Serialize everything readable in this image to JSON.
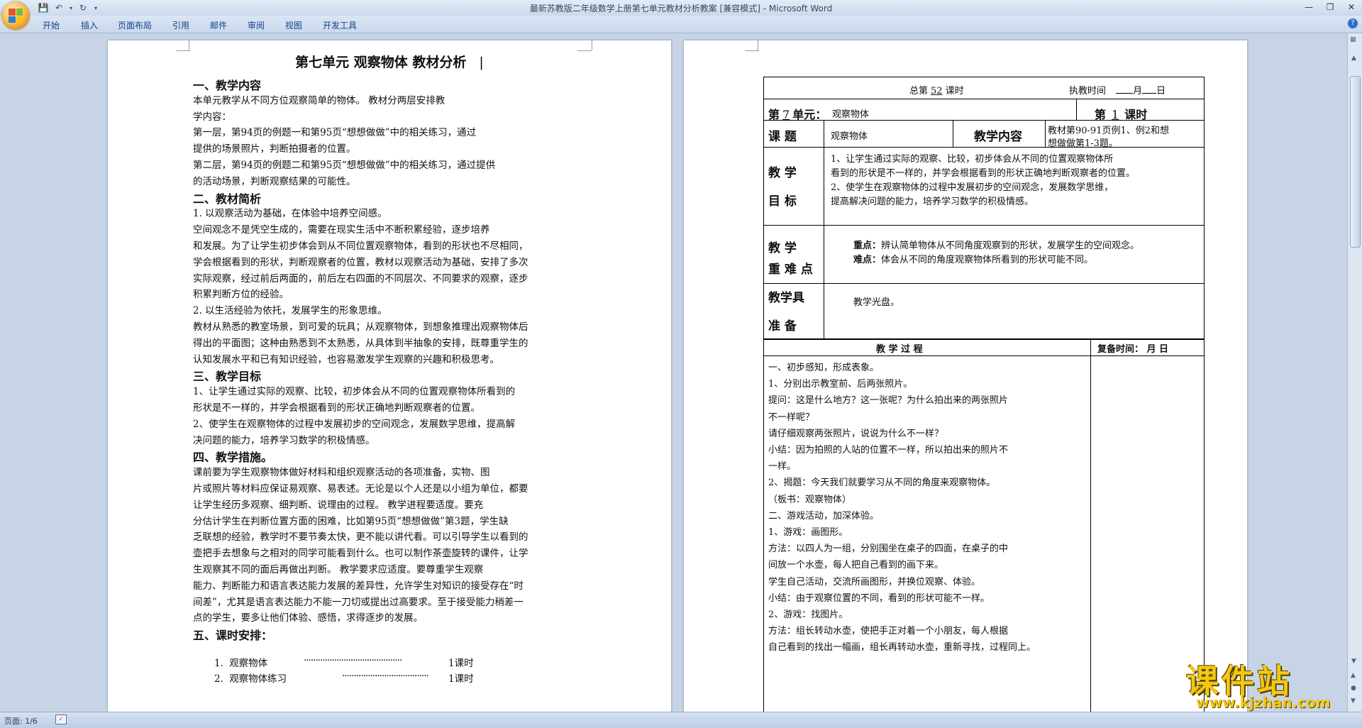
{
  "window": {
    "title": "最新苏教版二年级数学上册第七单元教材分析教案 [兼容模式] - Microsoft Word"
  },
  "ribbon": {
    "tabs": [
      "开始",
      "插入",
      "页面布局",
      "引用",
      "邮件",
      "审阅",
      "视图",
      "开发工具"
    ]
  },
  "page1": {
    "title": "第七单元 观察物体   教材分析",
    "lines": [
      {
        "text": "一、教学内容",
        "heading": true
      },
      {
        "text": "        本单元教学从不同方位观察简单的物体。          教材分两层安排教"
      },
      {
        "text": "学内容："
      },
      {
        "text": "    第一层，第94页的例题一和第95页“想想做做”中的相关练习，通过"
      },
      {
        "text": "提供的场景照片，判断拍摄者的位置。"
      },
      {
        "text": "  第二层，第94页的例题二和第95页“想想做做”中的相关练习，通过提供"
      },
      {
        "text": "的活动场景，判断观察结果的可能性。"
      },
      {
        "text": "二、教材简析",
        "heading": true
      },
      {
        "text": "      1. 以观察活动为基础，在体验中培养空间感。"
      },
      {
        "text": "        空间观念不是凭空生成的，需要在现实生活中不断积累经验，逐步培养"
      },
      {
        "text": "和发展。为了让学生初步体会到从不同位置观察物体，看到的形状也不尽相同，"
      },
      {
        "text": "学会根据看到的形状，判断观察者的位置，教材以观察活动为基础，安排了多次"
      },
      {
        "text": "实际观察，经过前后两面的，前后左右四面的不同层次、不同要求的观察，逐步"
      },
      {
        "text": "积累判断方位的经验。"
      },
      {
        "text": "      2. 以生活经验为依托，发展学生的形象思维。"
      },
      {
        "text": "教材从熟悉的教室场景，到可爱的玩具；从观察物体，到想象推理出观察物体后"
      },
      {
        "text": "得出的平面图；这种由熟悉到不太熟悉，从具体到半抽象的安排，既尊重学生的"
      },
      {
        "text": "认知发展水平和已有知识经验，也容易激发学生观察的兴趣和积极思考。"
      },
      {
        "text": "三、教学目标",
        "heading": true
      },
      {
        "text": "   1、让学生通过实际的观察、比较，初步体会从不同的位置观察物体所看到的"
      },
      {
        "text": "形状是不一样的，并学会根据看到的形状正确地判断观察者的位置。"
      },
      {
        "text": "  2、使学生在观察物体的过程中发展初步的空间观念，发展数学思维，提高解"
      },
      {
        "text": "决问题的能力，培养学习数学的积极情感。"
      },
      {
        "text": "四、教学措施。",
        "heading": true
      },
      {
        "text": "        课前要为学生观察物体做好材料和组织观察活动的各项准备，实物、图"
      },
      {
        "text": "片或照片等材料应保证易观察、易表述。无论是以个人还是以小组为单位，都要"
      },
      {
        "text": "让学生经历多观察、细判断、说理由的过程。          教学进程要适度。要充"
      },
      {
        "text": "分估计学生在判断位置方面的困难，比如第95页“想想做做”第3题，学生缺"
      },
      {
        "text": "乏联想的经验，教学时不要节奏太快，更不能以讲代看。可以引导学生以看到的"
      },
      {
        "text": "壶把手去想象与之相对的同学可能看到什么。也可以制作茶壶旋转的课件，让学"
      },
      {
        "text": "生观察其不同的面后再做出判断。          教学要求应适度。要尊重学生观察"
      },
      {
        "text": "能力、判断能力和语言表达能力发展的差异性，允许学生对知识的接受存在“时"
      },
      {
        "text": "间差”，尤其是语言表达能力不能一刀切或提出过高要求。至于接受能力稍差一"
      },
      {
        "text": "点的学生，要多让他们体验、感悟，求得逐步的发展。"
      },
      {
        "text": "五、课时安排：",
        "heading": true
      }
    ],
    "schedule": [
      {
        "num": "1.",
        "item": "观察物体",
        "leader": "··········································",
        "hours": "1课时"
      },
      {
        "num": "2.",
        "item": "观察物体练习",
        "leader": "·····································",
        "hours": "1课时"
      }
    ]
  },
  "page2": {
    "header": {
      "total_prefix": "总第",
      "total_no": "52",
      "total_suffix": "课时",
      "exec_label": "执教时间",
      "exec_month": "月",
      "exec_day": "日"
    },
    "unit": {
      "prefix": "第",
      "no": "7",
      "suffix": "单元：",
      "name": "观察物体",
      "lesson_prefix": "第",
      "lesson_no": "1",
      "lesson_suffix": "课时"
    },
    "topic": {
      "label": "课    题",
      "value": "观察物体",
      "content_label": "教学内容",
      "content": [
        "教材第90-91页例1、例2和想",
        "想做做第1-3题。"
      ]
    },
    "goals": {
      "label1": "教    学",
      "label2": "目    标",
      "lines": [
        "    1、让学生通过实际的观察、比较，初步体会从不同的位置观察物体所",
        "看到的形状是不一样的，并学会根据看到的形状正确地判断观察者的位置。",
        "    2、使学生在观察物体的过程中发展初步的空间观念，发展数学思维，",
        "提高解决问题的能力，培养学习数学的积极情感。"
      ]
    },
    "keypoints": {
      "label1": "教    学",
      "label2": "重 难 点",
      "key_label": "重点：",
      "key": "辨认简单物体从不同角度观察到的形状，发展学生的空间观念。",
      "diff_label": "难点：",
      "diff": "体会从不同的角度观察物体所看到的形状可能不同。"
    },
    "prep": {
      "label1": "教学具",
      "label2": "准    备",
      "value": "教学光盘。"
    },
    "process": {
      "label": "教    学    过    程",
      "review_label": "复备时间：  月  日",
      "lines": [
        "    一、初步感知，形成表象。",
        "    1、分别出示教室前、后两张照片。",
        "    提问：这是什么地方？这一张呢？为什么拍出来的两张照片",
        "不一样呢？",
        "    请仔细观察两张照片，说说为什么不一样？",
        "    小结：因为拍照的人站的位置不一样，所以拍出来的照片不",
        "一样。",
        "    2、揭题：今天我们就要学习从不同的角度来观察物体。",
        "   （板书：观察物体）",
        "    二、游戏活动，加深体验。",
        "    1、游戏：画图形。",
        "    方法：以四人为一组，分别围坐在桌子的四面，在桌子的中",
        "间放一个水壶，每人把自己看到的画下来。",
        "    学生自己活动，交流所画图形，并换位观察、体验。",
        "    小结：由于观察位置的不同，看到的形状可能不一样。",
        "    2、游戏：找图片。",
        "    方法：组长转动水壶，使把手正对着一个小朋友，每人根据",
        "自己看到的找出一幅画，组长再转动水壶，重新寻找，过程同上。"
      ]
    }
  },
  "status": {
    "page_info": "页面: 1/6"
  },
  "watermark": {
    "main": "课件站",
    "url": "www.kjzhan.com"
  },
  "colors": {
    "ribbon_text": "#15428b",
    "workspace": "#c7d4e6",
    "watermark": "#f2c812"
  }
}
